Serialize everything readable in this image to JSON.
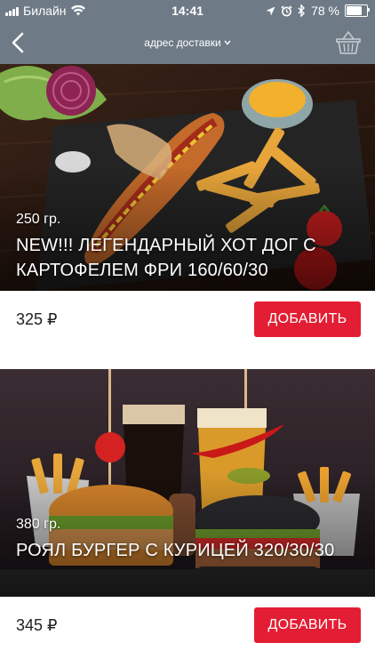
{
  "status_bar": {
    "carrier": "Билайн",
    "time": "14:41",
    "battery": "78 %",
    "battery_level": 0.78
  },
  "nav": {
    "address_label": "адрес доставки",
    "colors": {
      "bar": "#6e7b86"
    }
  },
  "products": [
    {
      "weight": "250 гр.",
      "title": "NEW!!! ЛЕГЕНДАРНЫЙ ХОТ ДОГ С КАРТОФЕЛЕМ ФРИ 160/60/30",
      "price": "325 ₽",
      "button_label": "ДОБАВИТЬ"
    },
    {
      "weight": "380 гр.",
      "title": "РОЯЛ БУРГЕР С КУРИЦЕЙ 320/30/30",
      "price": "345 ₽",
      "button_label": "ДОБАВИТЬ"
    }
  ],
  "colors": {
    "accent": "#e31e34"
  }
}
